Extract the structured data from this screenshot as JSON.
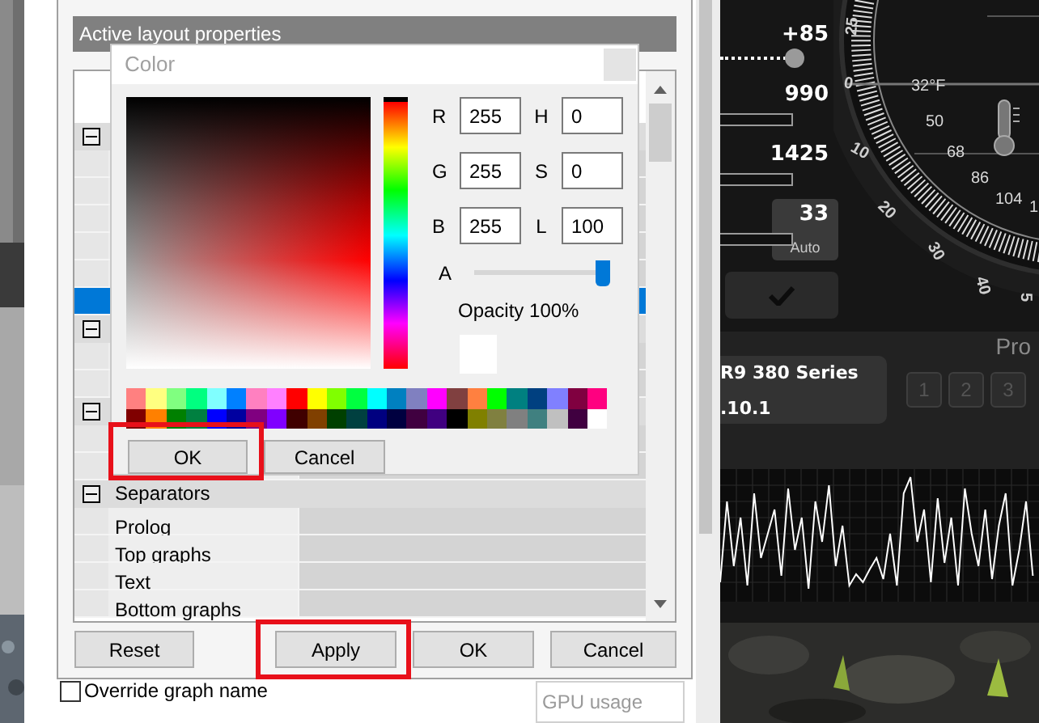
{
  "properties_dialog": {
    "header": "Active layout properties",
    "rows": [
      {
        "kind": "group",
        "expanded": true,
        "selected": false
      },
      {
        "kind": "item",
        "selected": false
      },
      {
        "kind": "item",
        "selected": false
      },
      {
        "kind": "item",
        "selected": false
      },
      {
        "kind": "item",
        "selected": false
      },
      {
        "kind": "item",
        "selected": false
      },
      {
        "kind": "item",
        "selected": true
      },
      {
        "kind": "group",
        "expanded": true,
        "selected": false
      },
      {
        "kind": "item",
        "selected": false
      },
      {
        "kind": "item",
        "selected": false
      },
      {
        "kind": "group",
        "expanded": true,
        "selected": false
      },
      {
        "kind": "item",
        "selected": false
      },
      {
        "kind": "item",
        "selected": false
      },
      {
        "kind": "group",
        "expanded": true,
        "selected": false,
        "label": "Separators"
      },
      {
        "kind": "item",
        "selected": false,
        "label": "Prolog"
      },
      {
        "kind": "item",
        "selected": false,
        "label": "Top graphs"
      },
      {
        "kind": "item",
        "selected": false,
        "label": "Text"
      },
      {
        "kind": "item",
        "selected": false,
        "label": "Bottom graphs"
      }
    ],
    "buttons": [
      {
        "label": "Reset",
        "highlighted": false
      },
      {
        "label": "Apply",
        "highlighted": true
      },
      {
        "label": "OK",
        "highlighted": false
      },
      {
        "label": "Cancel",
        "highlighted": false
      }
    ],
    "override_checkbox": {
      "label": "Override graph name",
      "checked": false
    },
    "graph_name_field": {
      "value": "GPU usage",
      "disabled": true
    }
  },
  "color_dialog": {
    "title": "Color",
    "fields": [
      {
        "label": "R",
        "value": "255"
      },
      {
        "label": "H",
        "value": "0"
      },
      {
        "label": "G",
        "value": "255"
      },
      {
        "label": "S",
        "value": "0"
      },
      {
        "label": "B",
        "value": "255"
      },
      {
        "label": "L",
        "value": "100"
      }
    ],
    "alpha": {
      "label": "A",
      "level": 1
    },
    "opacity": "Opacity 100%",
    "palette": [
      {
        "color": "#ff8080"
      },
      {
        "color": "#ffff80"
      },
      {
        "color": "#80ff80"
      },
      {
        "color": "#00ff80"
      },
      {
        "color": "#80ffff"
      },
      {
        "color": "#0080ff"
      },
      {
        "color": "#ff80c0"
      },
      {
        "color": "#ff80ff"
      },
      {
        "color": "#ff0000"
      },
      {
        "color": "#ffff00"
      },
      {
        "color": "#80ff00"
      },
      {
        "color": "#00ff40"
      },
      {
        "color": "#00ffff"
      },
      {
        "color": "#0080c0"
      },
      {
        "color": "#8080c0"
      },
      {
        "color": "#ff00ff"
      },
      {
        "color": "#804040"
      },
      {
        "color": "#ff8040"
      },
      {
        "color": "#00ff00"
      },
      {
        "color": "#008080"
      },
      {
        "color": "#004080"
      },
      {
        "color": "#8080ff"
      },
      {
        "color": "#800040"
      },
      {
        "color": "#ff0080"
      },
      {
        "color": "#800000"
      },
      {
        "color": "#ff8000"
      },
      {
        "color": "#008000"
      },
      {
        "color": "#008040"
      },
      {
        "color": "#0000ff"
      },
      {
        "color": "#0000a0"
      },
      {
        "color": "#800080"
      },
      {
        "color": "#8000ff"
      },
      {
        "color": "#400000"
      },
      {
        "color": "#804000"
      },
      {
        "color": "#004000"
      },
      {
        "color": "#004040"
      },
      {
        "color": "#000080"
      },
      {
        "color": "#000040"
      },
      {
        "color": "#400040"
      },
      {
        "color": "#400080"
      },
      {
        "color": "#000000"
      },
      {
        "color": "#808000"
      },
      {
        "color": "#808040"
      },
      {
        "color": "#808080"
      },
      {
        "color": "#408080"
      },
      {
        "color": "#c0c0c0"
      },
      {
        "color": "#400040"
      },
      {
        "color": "#ffffff"
      }
    ],
    "buttons": [
      {
        "label": "OK",
        "highlighted": true
      },
      {
        "label": "Cancel",
        "highlighted": false
      }
    ]
  },
  "monitor": {
    "readings": [
      {
        "kind": "knob",
        "reading": "+85",
        "level": 0.8
      },
      {
        "kind": "bar",
        "reading": "990"
      },
      {
        "kind": "bar",
        "reading": "1425"
      },
      {
        "kind": "fan",
        "reading": "33"
      }
    ],
    "auto_button": "Auto",
    "gauge": {
      "top_label": "25",
      "outer_scale": [
        "0",
        "10",
        "20",
        "30",
        "40",
        "5"
      ],
      "inner_scale": [
        "32°F",
        "50",
        "68",
        "86",
        "104",
        "1"
      ]
    },
    "profiles_label": "Pro",
    "device_name": "R9 380 Series",
    "driver_version": ".10.1",
    "profile_buttons": [
      "1",
      "2",
      "3"
    ]
  }
}
